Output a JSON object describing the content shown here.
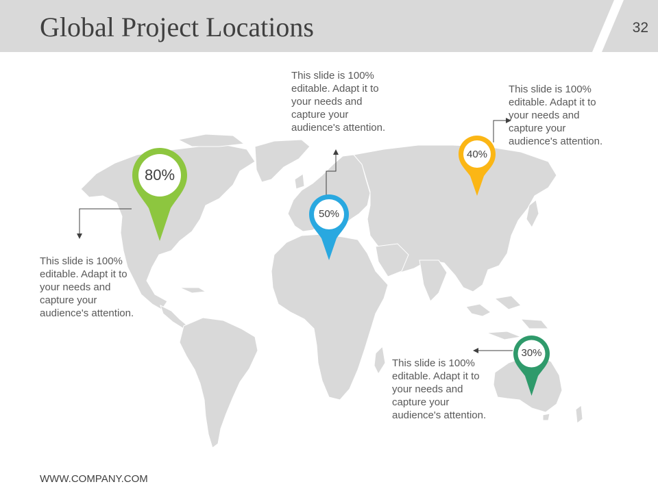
{
  "slide": {
    "title": "Global Project Locations",
    "page_number": "32",
    "footer": "WWW.COMPANY.COM"
  },
  "pins": [
    {
      "id": "north-america",
      "label": "80%",
      "color": "#8dc63f"
    },
    {
      "id": "europe",
      "label": "50%",
      "color": "#29a8e0"
    },
    {
      "id": "asia",
      "label": "40%",
      "color": "#fbb615"
    },
    {
      "id": "australia",
      "label": "30%",
      "color": "#2f9a6b"
    }
  ],
  "callouts": [
    {
      "id": "north-america",
      "text": "This slide is 100%\neditable. Adapt it to\nyour needs and\ncapture your\naudience's attention."
    },
    {
      "id": "europe",
      "text": "This slide is 100%\neditable. Adapt it to\nyour needs and\ncapture your\naudience's attention."
    },
    {
      "id": "asia",
      "text": "This slide is 100%\neditable. Adapt it to\nyour needs and\ncapture your\naudience's attention."
    },
    {
      "id": "australia",
      "text": "This slide is 100%\neditable. Adapt it to\nyour needs and\ncapture your\naudience's attention."
    }
  ],
  "colors": {
    "header_band": "#d9d9d9",
    "map_land": "#d9d9d9",
    "text": "#595959",
    "title": "#404040"
  }
}
